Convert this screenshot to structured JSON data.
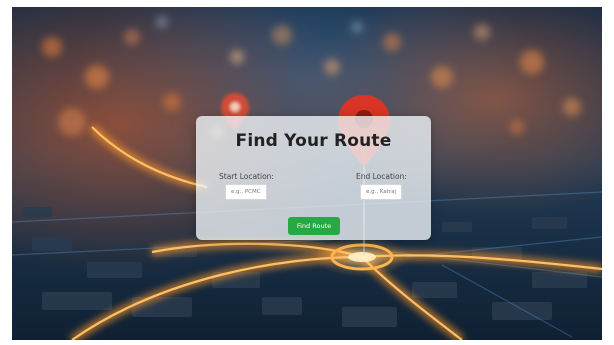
{
  "form": {
    "title": "Find Your Route",
    "start_label": "Start Location:",
    "start_placeholder": "e.g., PCMC",
    "start_value": "",
    "end_label": "End Location:",
    "end_placeholder": "e.g., Katraj",
    "end_value": "",
    "submit_label": "Find Route"
  },
  "colors": {
    "submit_button": "#28a745",
    "panel": "#eef2f6",
    "route_glow": "#ff9a2a",
    "map_pin": "#e8321f"
  },
  "icons": {
    "pin_large": "map-pin-icon",
    "pin_small": "map-pin-icon"
  }
}
